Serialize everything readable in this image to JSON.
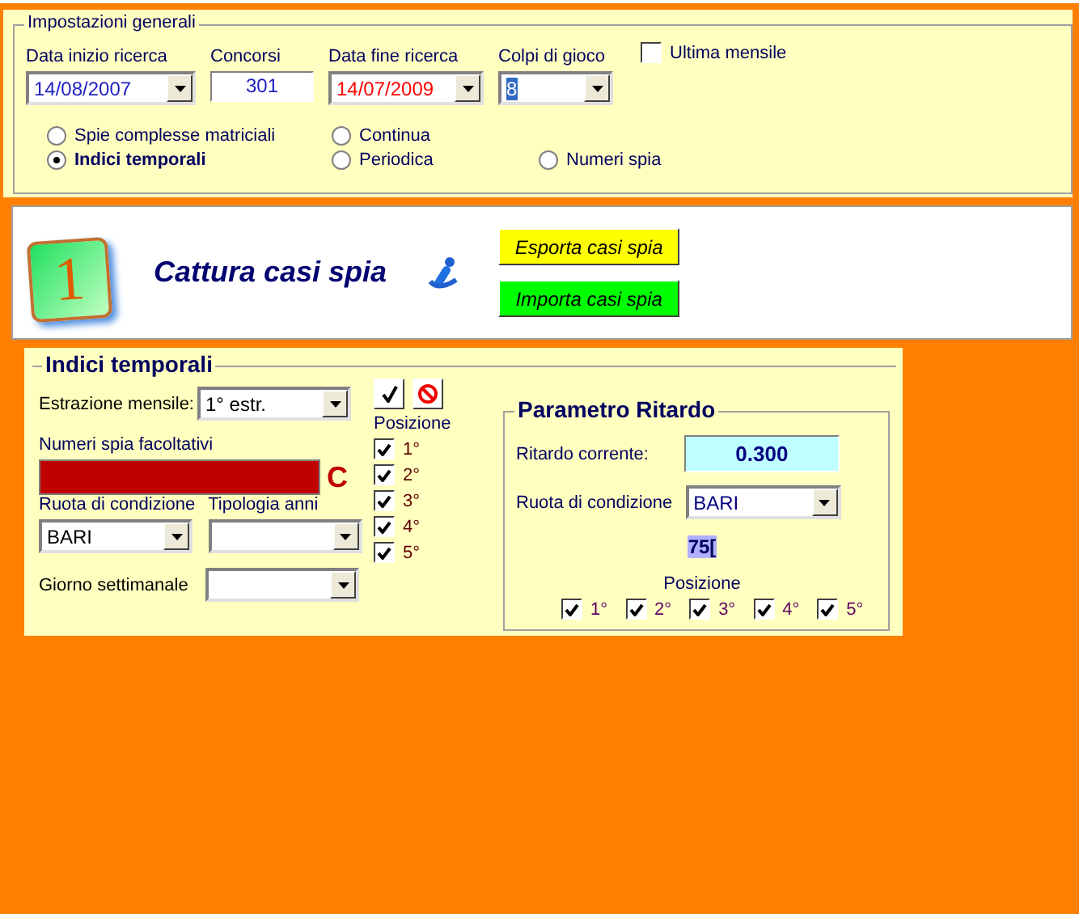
{
  "general": {
    "title": "Impostazioni generali",
    "fields": [
      {
        "label": "Data inizio ricerca",
        "value": "14/08/2007",
        "kind": "dropdown",
        "color": "#2020c0",
        "highlighted": false
      },
      {
        "label": "Concorsi",
        "value": "301",
        "kind": "text",
        "color": "#2020c0",
        "highlighted": false
      },
      {
        "label": "Data fine ricerca",
        "value": "14/07/2009",
        "kind": "dropdown",
        "color": "#ff0000",
        "highlighted": false
      },
      {
        "label": "Colpi di gioco",
        "value": "8",
        "kind": "dropdown",
        "highlighted": true
      }
    ],
    "last_monthly": {
      "label": "Ultima mensile",
      "checked": false
    },
    "radio_columns": [
      [
        {
          "label": "Spie complesse matriciali",
          "selected": false
        },
        {
          "label": "Indici temporali",
          "selected": true
        }
      ],
      [
        {
          "label": "Continua",
          "selected": false
        },
        {
          "label": "Periodica",
          "selected": false
        }
      ],
      [
        {
          "label": "Numeri spia",
          "selected": false
        }
      ]
    ]
  },
  "banner": {
    "badge": "1",
    "title": "Cattura casi spia",
    "buttons": [
      {
        "label": "Esporta casi spia",
        "color": "#ffff00"
      },
      {
        "label": "Importa casi spia",
        "color": "#00ff00"
      }
    ]
  },
  "temporal": {
    "title": "Indici temporali",
    "monthly_extraction": {
      "label": "Estrazione mensile:",
      "value": "1° estr."
    },
    "optional_numbers": {
      "label": "Numeri spia facoltativi",
      "clear": "C"
    },
    "wheel": {
      "label": "Ruota di condizione",
      "value": "BARI"
    },
    "years_type": {
      "label": "Tipologia anni"
    },
    "weekday": {
      "label": "Giorno settimanale"
    },
    "positions": {
      "label": "Posizione",
      "items": [
        {
          "label": "1°",
          "checked": true
        },
        {
          "label": "2°",
          "checked": true
        },
        {
          "label": "3°",
          "checked": true
        },
        {
          "label": "4°",
          "checked": true
        },
        {
          "label": "5°",
          "checked": true
        }
      ]
    },
    "delay": {
      "title": "Parametro Ritardo",
      "current": {
        "label": "Ritardo corrente:",
        "value": "0.300"
      },
      "wheel": {
        "label": "Ruota di condizione",
        "value": "BARI"
      },
      "marker": "75[",
      "positions": {
        "label": "Posizione",
        "items": [
          {
            "label": "1°",
            "checked": true
          },
          {
            "label": "2°",
            "checked": true
          },
          {
            "label": "3°",
            "checked": true
          },
          {
            "label": "4°",
            "checked": true
          },
          {
            "label": "5°",
            "checked": true
          }
        ]
      }
    }
  }
}
